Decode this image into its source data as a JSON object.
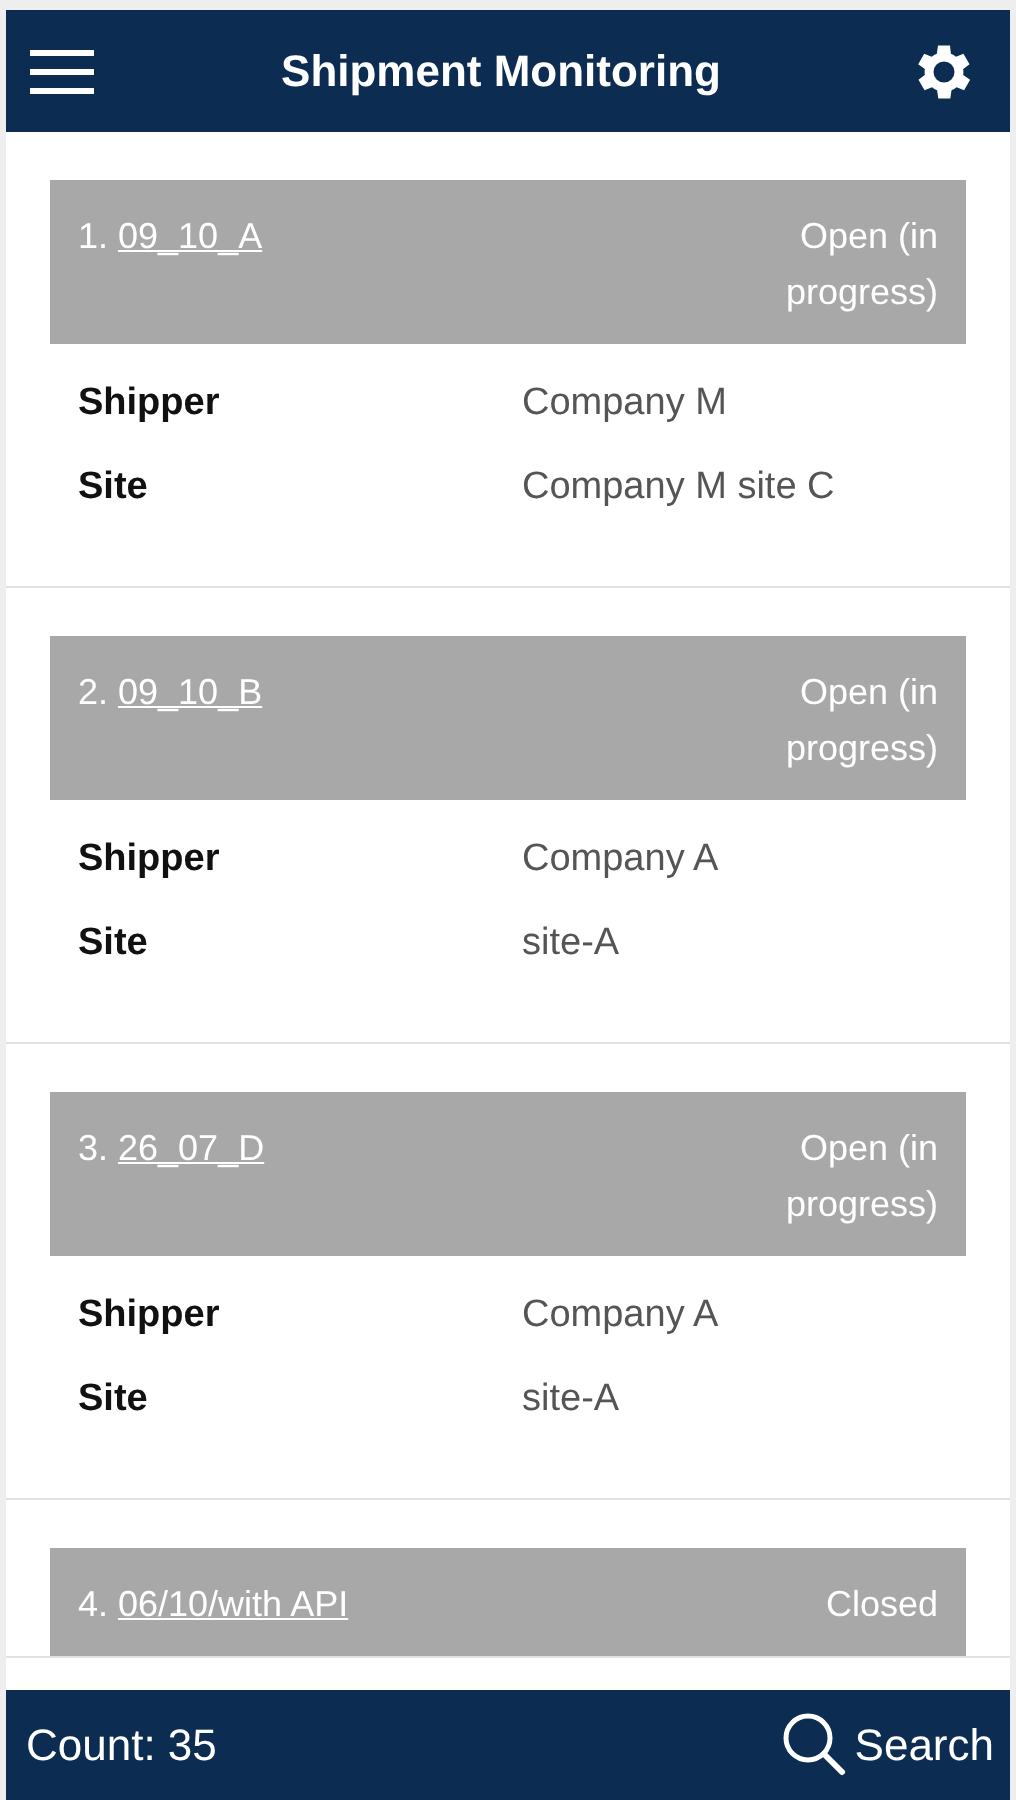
{
  "header": {
    "title": "Shipment Monitoring"
  },
  "shipments": [
    {
      "number": "1.",
      "name": "09_10_A",
      "status": "Open (in progress)",
      "fields": [
        {
          "label": "Shipper",
          "value": "Company M"
        },
        {
          "label": "Site",
          "value": "Company M site C"
        }
      ]
    },
    {
      "number": "2.",
      "name": "09_10_B",
      "status": "Open (in progress)",
      "fields": [
        {
          "label": "Shipper",
          "value": "Company A"
        },
        {
          "label": "Site",
          "value": "site-A"
        }
      ]
    },
    {
      "number": "3.",
      "name": "26_07_D",
      "status": "Open (in progress)",
      "fields": [
        {
          "label": "Shipper",
          "value": "Company A"
        },
        {
          "label": "Site",
          "value": "site-A"
        }
      ]
    },
    {
      "number": "4.",
      "name": "06/10/with API",
      "status": "Closed"
    }
  ],
  "footer": {
    "count": "Count: 35",
    "search": "Search"
  }
}
